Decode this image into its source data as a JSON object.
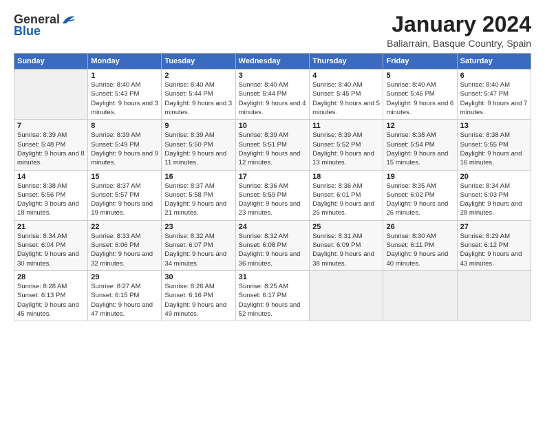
{
  "logo": {
    "general": "General",
    "blue": "Blue"
  },
  "title": "January 2024",
  "subtitle": "Baliarrain, Basque Country, Spain",
  "days_header": [
    "Sunday",
    "Monday",
    "Tuesday",
    "Wednesday",
    "Thursday",
    "Friday",
    "Saturday"
  ],
  "weeks": [
    [
      {
        "day": "",
        "sunrise": "",
        "sunset": "",
        "daylight": ""
      },
      {
        "day": "1",
        "sunrise": "Sunrise: 8:40 AM",
        "sunset": "Sunset: 5:43 PM",
        "daylight": "Daylight: 9 hours and 3 minutes."
      },
      {
        "day": "2",
        "sunrise": "Sunrise: 8:40 AM",
        "sunset": "Sunset: 5:44 PM",
        "daylight": "Daylight: 9 hours and 3 minutes."
      },
      {
        "day": "3",
        "sunrise": "Sunrise: 8:40 AM",
        "sunset": "Sunset: 5:44 PM",
        "daylight": "Daylight: 9 hours and 4 minutes."
      },
      {
        "day": "4",
        "sunrise": "Sunrise: 8:40 AM",
        "sunset": "Sunset: 5:45 PM",
        "daylight": "Daylight: 9 hours and 5 minutes."
      },
      {
        "day": "5",
        "sunrise": "Sunrise: 8:40 AM",
        "sunset": "Sunset: 5:46 PM",
        "daylight": "Daylight: 9 hours and 6 minutes."
      },
      {
        "day": "6",
        "sunrise": "Sunrise: 8:40 AM",
        "sunset": "Sunset: 5:47 PM",
        "daylight": "Daylight: 9 hours and 7 minutes."
      }
    ],
    [
      {
        "day": "7",
        "sunrise": "Sunrise: 8:39 AM",
        "sunset": "Sunset: 5:48 PM",
        "daylight": "Daylight: 9 hours and 8 minutes."
      },
      {
        "day": "8",
        "sunrise": "Sunrise: 8:39 AM",
        "sunset": "Sunset: 5:49 PM",
        "daylight": "Daylight: 9 hours and 9 minutes."
      },
      {
        "day": "9",
        "sunrise": "Sunrise: 8:39 AM",
        "sunset": "Sunset: 5:50 PM",
        "daylight": "Daylight: 9 hours and 11 minutes."
      },
      {
        "day": "10",
        "sunrise": "Sunrise: 8:39 AM",
        "sunset": "Sunset: 5:51 PM",
        "daylight": "Daylight: 9 hours and 12 minutes."
      },
      {
        "day": "11",
        "sunrise": "Sunrise: 8:39 AM",
        "sunset": "Sunset: 5:52 PM",
        "daylight": "Daylight: 9 hours and 13 minutes."
      },
      {
        "day": "12",
        "sunrise": "Sunrise: 8:38 AM",
        "sunset": "Sunset: 5:54 PM",
        "daylight": "Daylight: 9 hours and 15 minutes."
      },
      {
        "day": "13",
        "sunrise": "Sunrise: 8:38 AM",
        "sunset": "Sunset: 5:55 PM",
        "daylight": "Daylight: 9 hours and 16 minutes."
      }
    ],
    [
      {
        "day": "14",
        "sunrise": "Sunrise: 8:38 AM",
        "sunset": "Sunset: 5:56 PM",
        "daylight": "Daylight: 9 hours and 18 minutes."
      },
      {
        "day": "15",
        "sunrise": "Sunrise: 8:37 AM",
        "sunset": "Sunset: 5:57 PM",
        "daylight": "Daylight: 9 hours and 19 minutes."
      },
      {
        "day": "16",
        "sunrise": "Sunrise: 8:37 AM",
        "sunset": "Sunset: 5:58 PM",
        "daylight": "Daylight: 9 hours and 21 minutes."
      },
      {
        "day": "17",
        "sunrise": "Sunrise: 8:36 AM",
        "sunset": "Sunset: 5:59 PM",
        "daylight": "Daylight: 9 hours and 23 minutes."
      },
      {
        "day": "18",
        "sunrise": "Sunrise: 8:36 AM",
        "sunset": "Sunset: 6:01 PM",
        "daylight": "Daylight: 9 hours and 25 minutes."
      },
      {
        "day": "19",
        "sunrise": "Sunrise: 8:35 AM",
        "sunset": "Sunset: 6:02 PM",
        "daylight": "Daylight: 9 hours and 26 minutes."
      },
      {
        "day": "20",
        "sunrise": "Sunrise: 8:34 AM",
        "sunset": "Sunset: 6:03 PM",
        "daylight": "Daylight: 9 hours and 28 minutes."
      }
    ],
    [
      {
        "day": "21",
        "sunrise": "Sunrise: 8:34 AM",
        "sunset": "Sunset: 6:04 PM",
        "daylight": "Daylight: 9 hours and 30 minutes."
      },
      {
        "day": "22",
        "sunrise": "Sunrise: 8:33 AM",
        "sunset": "Sunset: 6:06 PM",
        "daylight": "Daylight: 9 hours and 32 minutes."
      },
      {
        "day": "23",
        "sunrise": "Sunrise: 8:32 AM",
        "sunset": "Sunset: 6:07 PM",
        "daylight": "Daylight: 9 hours and 34 minutes."
      },
      {
        "day": "24",
        "sunrise": "Sunrise: 8:32 AM",
        "sunset": "Sunset: 6:08 PM",
        "daylight": "Daylight: 9 hours and 36 minutes."
      },
      {
        "day": "25",
        "sunrise": "Sunrise: 8:31 AM",
        "sunset": "Sunset: 6:09 PM",
        "daylight": "Daylight: 9 hours and 38 minutes."
      },
      {
        "day": "26",
        "sunrise": "Sunrise: 8:30 AM",
        "sunset": "Sunset: 6:11 PM",
        "daylight": "Daylight: 9 hours and 40 minutes."
      },
      {
        "day": "27",
        "sunrise": "Sunrise: 8:29 AM",
        "sunset": "Sunset: 6:12 PM",
        "daylight": "Daylight: 9 hours and 43 minutes."
      }
    ],
    [
      {
        "day": "28",
        "sunrise": "Sunrise: 8:28 AM",
        "sunset": "Sunset: 6:13 PM",
        "daylight": "Daylight: 9 hours and 45 minutes."
      },
      {
        "day": "29",
        "sunrise": "Sunrise: 8:27 AM",
        "sunset": "Sunset: 6:15 PM",
        "daylight": "Daylight: 9 hours and 47 minutes."
      },
      {
        "day": "30",
        "sunrise": "Sunrise: 8:26 AM",
        "sunset": "Sunset: 6:16 PM",
        "daylight": "Daylight: 9 hours and 49 minutes."
      },
      {
        "day": "31",
        "sunrise": "Sunrise: 8:25 AM",
        "sunset": "Sunset: 6:17 PM",
        "daylight": "Daylight: 9 hours and 52 minutes."
      },
      {
        "day": "",
        "sunrise": "",
        "sunset": "",
        "daylight": ""
      },
      {
        "day": "",
        "sunrise": "",
        "sunset": "",
        "daylight": ""
      },
      {
        "day": "",
        "sunrise": "",
        "sunset": "",
        "daylight": ""
      }
    ]
  ]
}
